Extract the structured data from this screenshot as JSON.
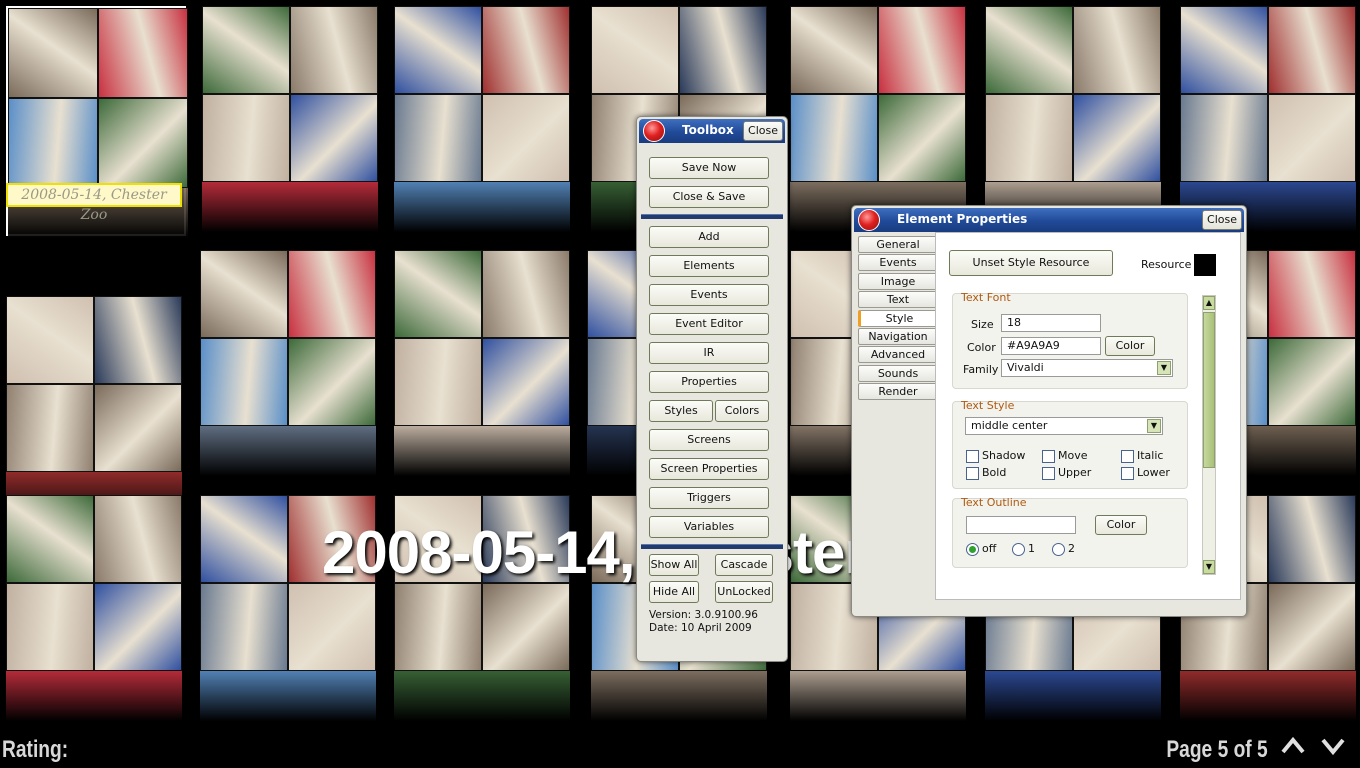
{
  "wall": {
    "selected_caption": "2008-05-14, Chester Zoo",
    "big_caption": "2008-05-14, Chester Zoo",
    "colors": [
      "#7a6a5a",
      "#c83040",
      "#5a8fc8",
      "#3d6a3a",
      "#8a7a6a",
      "#c0b0a0",
      "#3050a0",
      "#a03030",
      "#6a7a90",
      "#d0c0b0",
      "#2a3a5a",
      "#908070"
    ]
  },
  "bottom": {
    "rating_label": "Rating:",
    "page_label": "Page 5 of  5",
    "up_glyph": "⌃",
    "down_glyph": "⌄"
  },
  "toolbox": {
    "title": "Toolbox",
    "close": "Close",
    "buttons": {
      "save_now": "Save Now",
      "close_save": "Close & Save",
      "add": "Add",
      "elements": "Elements",
      "events": "Events",
      "event_editor": "Event Editor",
      "ir": "IR",
      "properties": "Properties",
      "styles": "Styles",
      "colors": "Colors",
      "screens": "Screens",
      "screen_properties": "Screen Properties",
      "triggers": "Triggers",
      "variables": "Variables",
      "show_all": "Show All",
      "cascade": "Cascade",
      "hide_all": "Hide All",
      "unlocked": "UnLocked"
    },
    "version": "Version: 3.0.9100.96",
    "date": "Date: 10 April 2009"
  },
  "props": {
    "title": "Element Properties",
    "close": "Close",
    "tabs": [
      "General",
      "Events",
      "Image",
      "Text",
      "Style",
      "Navigation",
      "Advanced",
      "Sounds",
      "Render"
    ],
    "active_tab": "Style",
    "unset_button": "Unset Style Resource",
    "resource_label": "Resource",
    "resource_color": "#000000",
    "text_font": {
      "title": "Text Font",
      "size_label": "Size",
      "size_value": "18",
      "color_label": "Color",
      "color_value": "#A9A9A9",
      "color_button": "Color",
      "family_label": "Family",
      "family_value": "Vivaldi"
    },
    "text_style": {
      "title": "Text Style",
      "alignment": "middle center",
      "options": {
        "shadow": "Shadow",
        "move": "Move",
        "italic": "Italic",
        "bold": "Bold",
        "upper": "Upper",
        "lower": "Lower"
      }
    },
    "text_outline": {
      "title": "Text Outline",
      "value": "",
      "color_button": "Color",
      "radio_off": "off",
      "radio_1": "1",
      "radio_2": "2",
      "selected": "off"
    }
  }
}
